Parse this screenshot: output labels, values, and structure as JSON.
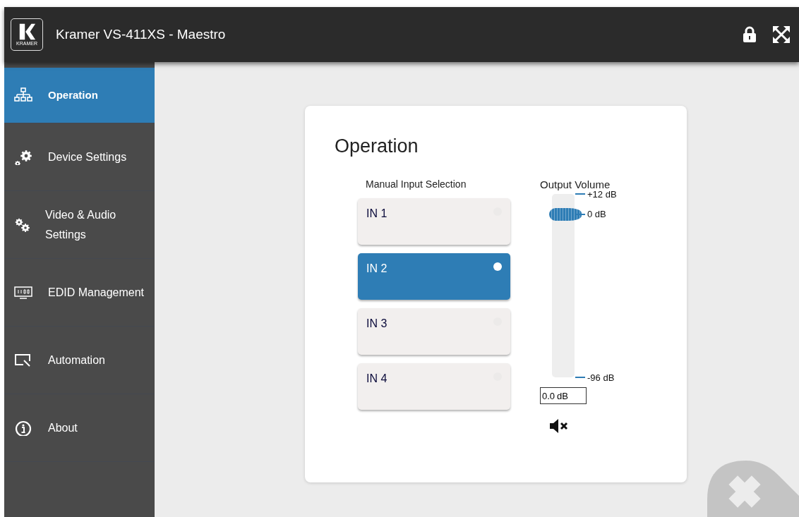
{
  "header": {
    "logo_text": "KRAMER",
    "title": "Kramer VS-411XS - Maestro"
  },
  "sidebar": {
    "items": [
      {
        "label": "Operation",
        "kind": "tree",
        "selected": true
      },
      {
        "label": "Device Settings",
        "kind": "gears",
        "selected": false
      },
      {
        "label": "Video & Audio Settings",
        "kind": "cogs",
        "selected": false
      },
      {
        "label": "EDID Management",
        "kind": "edid",
        "selected": false
      },
      {
        "label": "Automation",
        "kind": "automation",
        "selected": false
      },
      {
        "label": "About",
        "kind": "info",
        "selected": false
      }
    ]
  },
  "panel": {
    "title": "Operation",
    "input_selection": {
      "label": "Manual Input Selection",
      "inputs": [
        {
          "label": "IN 1",
          "selected": false
        },
        {
          "label": "IN 2",
          "selected": true
        },
        {
          "label": "IN 3",
          "selected": false
        },
        {
          "label": "IN 4",
          "selected": false
        }
      ]
    },
    "output_volume": {
      "label": "Output Volume",
      "level": 0.889,
      "max_label": "+12 dB",
      "current_label": "0 dB",
      "min_label": "-96 dB",
      "value": "0.0",
      "unit": "dB"
    }
  }
}
